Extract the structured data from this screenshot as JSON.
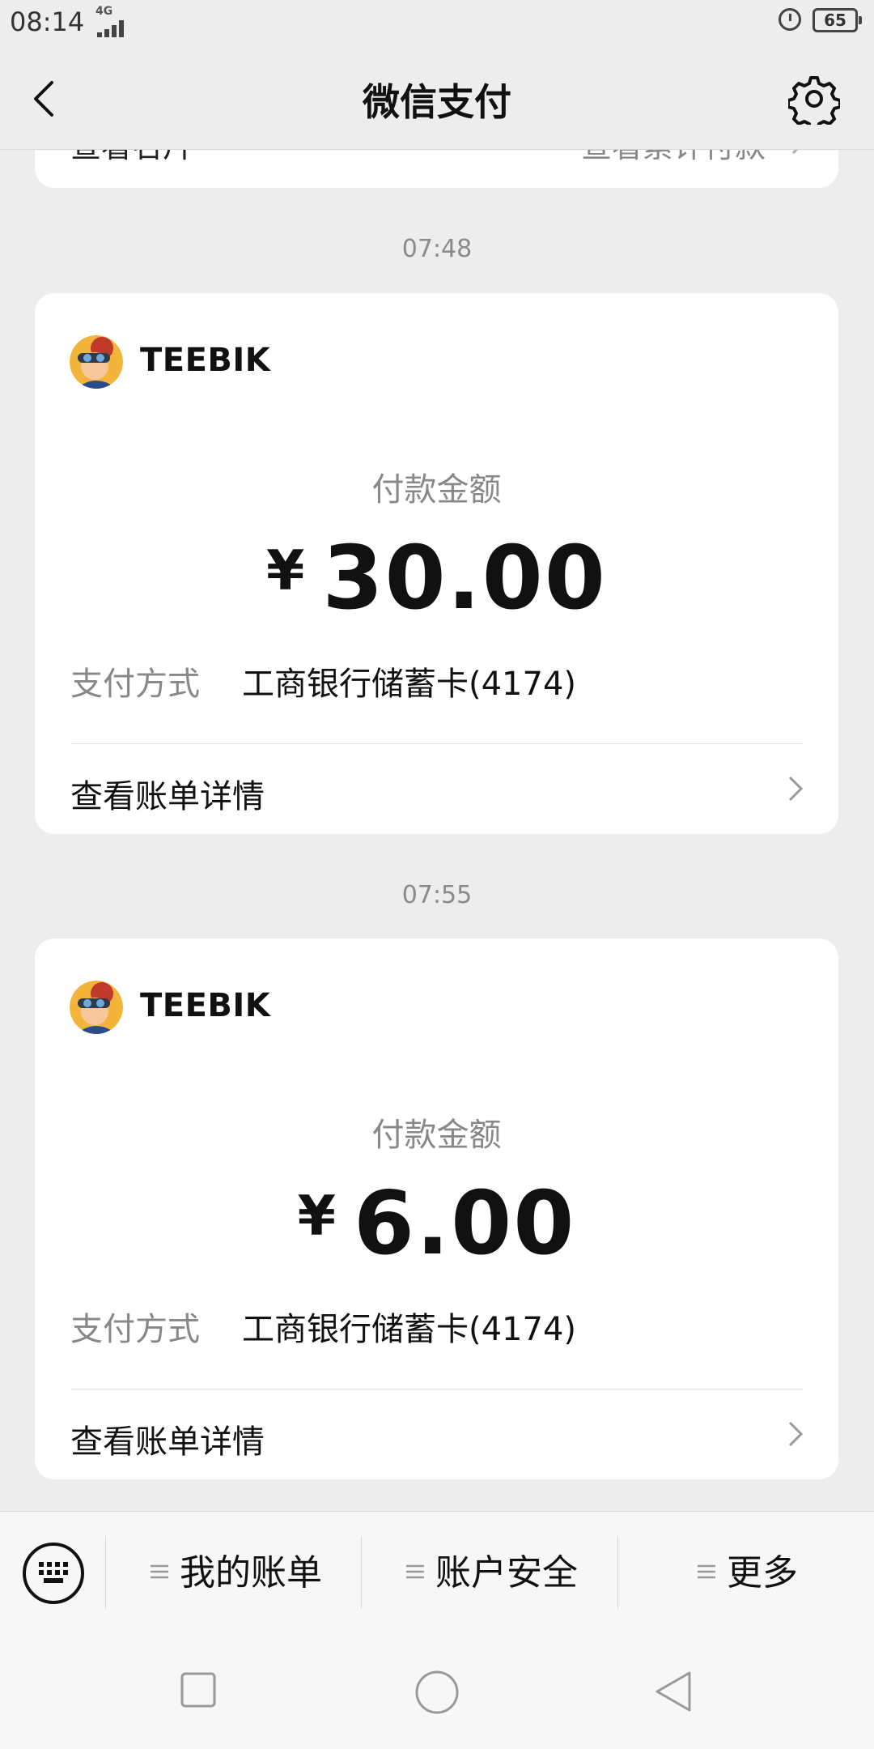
{
  "status_bar": {
    "time": "08:14",
    "network": "4G",
    "battery": "65"
  },
  "nav": {
    "title": "微信支付"
  },
  "prev_card": {
    "left": "查看名片",
    "right": "查看累计付款"
  },
  "payments": [
    {
      "time": "07:48",
      "merchant": "TEEBIK",
      "amount_label": "付款金额",
      "currency": "¥",
      "amount": "30.00",
      "method_label": "支付方式",
      "method_value": "工商银行储蓄卡(4174)",
      "detail_link": "查看账单详情"
    },
    {
      "time": "07:55",
      "merchant": "TEEBIK",
      "amount_label": "付款金额",
      "currency": "¥",
      "amount": "6.00",
      "method_label": "支付方式",
      "method_value": "工商银行储蓄卡(4174)",
      "detail_link": "查看账单详情"
    }
  ],
  "bottom_menu": {
    "items": [
      {
        "label": "我的账单"
      },
      {
        "label": "账户安全"
      },
      {
        "label": "更多"
      }
    ]
  },
  "icons": {
    "back": "chevron-left-icon",
    "settings": "gear-icon",
    "keyboard": "keyboard-icon",
    "menu": "menu-lines-icon"
  },
  "colors": {
    "background": "#ededed",
    "card": "#ffffff",
    "muted_text": "#888888"
  }
}
